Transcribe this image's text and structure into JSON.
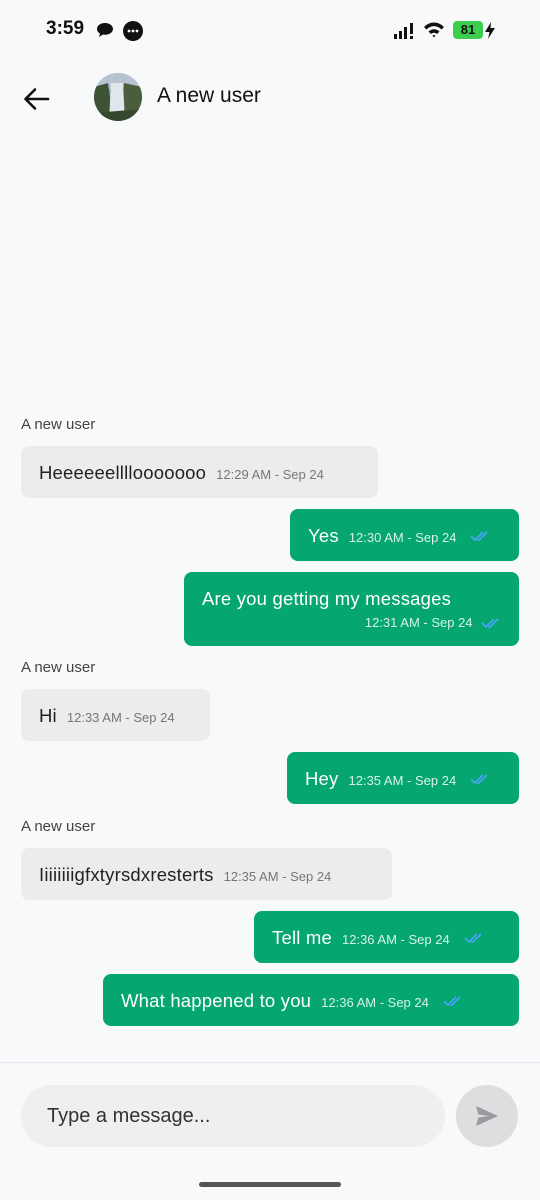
{
  "status_bar": {
    "time": "3:59",
    "battery": "81"
  },
  "header": {
    "contact_name": "A new user"
  },
  "messages": [
    {
      "sender": "A new user",
      "direction": "in",
      "text": "Heeeeeellllooooooo",
      "time": "12:29 AM - Sep 24"
    },
    {
      "direction": "out",
      "text": "Yes",
      "time": "12:30 AM - Sep 24"
    },
    {
      "direction": "out",
      "text": "Are you getting my messages",
      "time": "12:31 AM - Sep 24"
    },
    {
      "sender": "A new user",
      "direction": "in",
      "text": "Hi",
      "time": "12:33 AM - Sep 24"
    },
    {
      "direction": "out",
      "text": "Hey",
      "time": "12:35 AM - Sep 24"
    },
    {
      "sender": "A new user",
      "direction": "in",
      "text": "Iiiiiiiigfxtyrsdxresterts",
      "time": "12:35 AM - Sep 24"
    },
    {
      "direction": "out",
      "text": "Tell me",
      "time": "12:36 AM - Sep 24"
    },
    {
      "direction": "out",
      "text": "What happened to you",
      "time": "12:36 AM - Sep 24"
    }
  ],
  "composer": {
    "placeholder": "Type a message..."
  },
  "colors": {
    "outgoing_bubble": "#05a66f",
    "incoming_bubble": "#ececee",
    "read_ticks": "#4aa3ff"
  }
}
